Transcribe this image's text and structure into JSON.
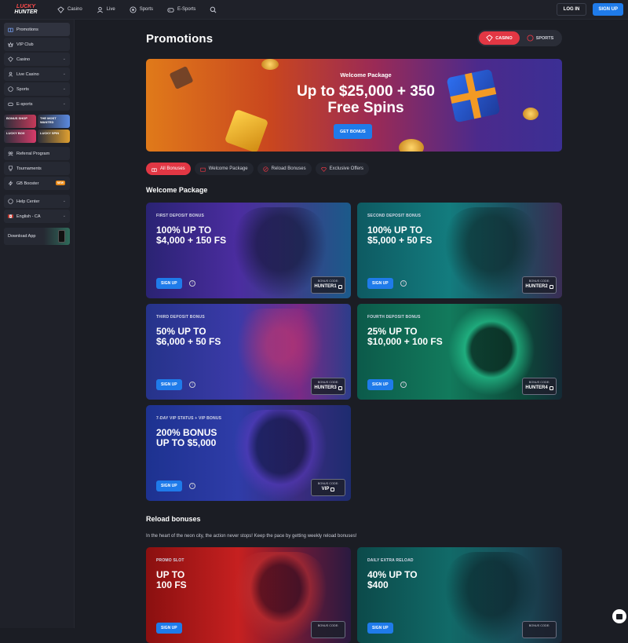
{
  "brand": {
    "line1": "LUCKY",
    "line2": "HUNTER"
  },
  "topnav": [
    {
      "label": "Casino",
      "icon": "casino-icon"
    },
    {
      "label": "Live",
      "icon": "live-icon"
    },
    {
      "label": "Sports",
      "icon": "sports-icon"
    },
    {
      "label": "E-Sports",
      "icon": "esports-icon"
    }
  ],
  "auth": {
    "login": "LOG IN",
    "signup": "SIGN UP"
  },
  "sidebar": {
    "items_top": [
      {
        "label": "Promotions",
        "icon": "promotions-icon",
        "active": true,
        "chevron": false
      },
      {
        "label": "VIP Club",
        "icon": "vip-icon",
        "chevron": false
      },
      {
        "label": "Casino",
        "icon": "casino-icon",
        "chevron": true
      },
      {
        "label": "Live Casino",
        "icon": "live-casino-icon",
        "chevron": true
      },
      {
        "label": "Sports",
        "icon": "sports-icon",
        "chevron": true
      },
      {
        "label": "E-sports",
        "icon": "esports-icon",
        "chevron": true
      }
    ],
    "tiles": [
      {
        "label": "BONUS SHOP"
      },
      {
        "label": "THE MOST WANTED"
      },
      {
        "label": "LUCKY BOX"
      },
      {
        "label": "LUCKY SPIN"
      }
    ],
    "items_bottom": [
      {
        "label": "Referral Program",
        "icon": "referral-icon"
      },
      {
        "label": "Tournaments",
        "icon": "trophy-icon"
      },
      {
        "label": "GB Booster",
        "icon": "booster-icon",
        "badge": "NEW"
      },
      {
        "label": "Help Center",
        "icon": "help-icon",
        "chevron": true
      },
      {
        "label": "English - CA",
        "icon": "flag-icon",
        "chevron": true
      },
      {
        "label": "Download App",
        "icon": "download-icon"
      }
    ]
  },
  "page": {
    "title": "Promotions"
  },
  "toggle": {
    "casino": "CASINO",
    "sports": "SPORTS"
  },
  "hero": {
    "subtitle": "Welcome Package",
    "line1": "Up to $25,000 + 350",
    "line2": "Free Spins",
    "button": "GET BONUS"
  },
  "filters": [
    {
      "label": "All Bonuses",
      "active": true
    },
    {
      "label": "Welcome Package"
    },
    {
      "label": "Reload Bonuses"
    },
    {
      "label": "Exclusive Offers"
    }
  ],
  "welcome": {
    "heading": "Welcome Package",
    "cards": [
      {
        "label": "FIRST DEPOSIT BONUS",
        "title": "100% UP TO\n$4,000 + 150 FS",
        "button": "SIGN UP",
        "code_label": "BONUS CODE:",
        "code": "HUNTER1"
      },
      {
        "label": "SECOND DEPOSIT BONUS",
        "title": "100% UP TO\n$5,000 + 50 FS",
        "button": "SIGN UP",
        "code_label": "BONUS CODE:",
        "code": "HUNTER2"
      },
      {
        "label": "THIRD DEPOSIT BONUS",
        "title": "50% UP TO\n$6,000 + 50 FS",
        "button": "SIGN UP",
        "code_label": "BONUS CODE:",
        "code": "HUNTER3"
      },
      {
        "label": "FOURTH DEPOSIT BONUS",
        "title": "25% UP TO\n$10,000 + 100 FS",
        "button": "SIGN UP",
        "code_label": "BONUS CODE:",
        "code": "HUNTER4"
      },
      {
        "label": "7-DAY VIP STATUS + VIP BONUS",
        "title": "200% BONUS\nUP TO $5,000",
        "button": "SIGN UP",
        "code_label": "BONUS CODE:",
        "code": "VIP"
      }
    ]
  },
  "reload": {
    "heading": "Reload bonuses",
    "description": "In the heart of the neon city, the action never stops! Keep the pace by getting weekly reload bonuses!",
    "cards": [
      {
        "label": "PROMO SLOT",
        "title": "UP TO\n100 FS",
        "button": "SIGN UP",
        "code_label": "BONUS CODE:"
      },
      {
        "label": "DAILY EXTRA RELOAD",
        "title": "40% UP TO\n$400",
        "button": "SIGN UP",
        "code_label": "BONUS CODE:"
      }
    ]
  },
  "colors": {
    "accent_red": "#e23744",
    "accent_blue": "#1f7bea",
    "bg": "#1b1d24",
    "panel": "#1f2129"
  }
}
